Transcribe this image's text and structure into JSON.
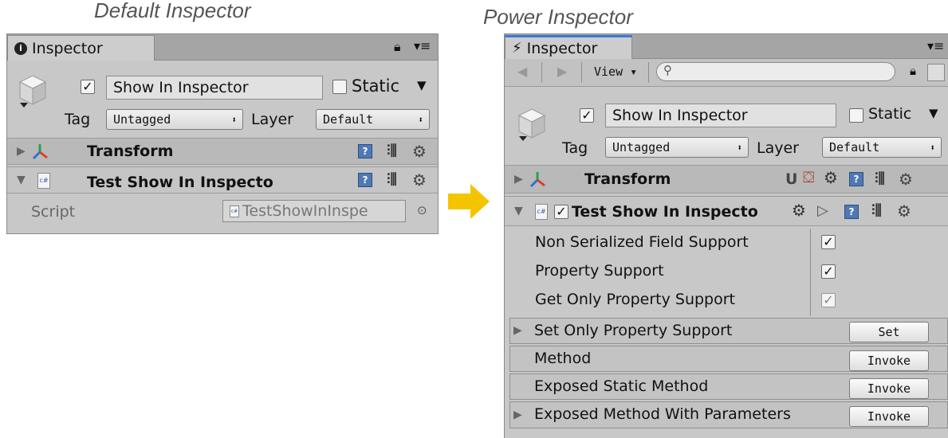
{
  "captions": {
    "left": "Default Inspector",
    "right": "Power Inspector"
  },
  "default_inspector": {
    "tab_title": "Inspector",
    "icons": [
      "info-icon",
      "lock-icon",
      "menu-icon",
      "cube-icon",
      "transform-axes-icon",
      "csharp-file-icon",
      "help-icon",
      "presets-icon",
      "gear-icon",
      "object-picker-icon"
    ],
    "gameobject": {
      "active": true,
      "name": "Show In Inspector",
      "static_label": "Static",
      "static_checked": false,
      "tag_label": "Tag",
      "tag_value": "Untagged",
      "layer_label": "Layer",
      "layer_value": "Default"
    },
    "components": [
      {
        "name": "Transform",
        "expanded": false
      },
      {
        "name": "Test Show In Inspecto",
        "expanded": true
      }
    ],
    "script_label": "Script",
    "script_value": "TestShowInInspe"
  },
  "power_inspector": {
    "tab_title": "Inspector",
    "view_label": "View",
    "search_placeholder": "",
    "icons": [
      "lightning-icon",
      "back-arrow-icon",
      "forward-arrow-icon",
      "search-icon",
      "lock-icon",
      "menu-icon",
      "cube-icon",
      "transform-axes-icon",
      "csharp-file-icon",
      "help-icon",
      "presets-icon",
      "gear-icon"
    ],
    "gameobject": {
      "active": true,
      "name": "Show In Inspector",
      "static_label": "Static",
      "static_checked": false,
      "tag_label": "Tag",
      "tag_value": "Untagged",
      "layer_label": "Layer",
      "layer_value": "Default"
    },
    "components": [
      {
        "name": "Transform",
        "expanded": false,
        "extra_icons": [
          "u-icon",
          "snap-cube-icon",
          "gear-arrow-icon"
        ]
      },
      {
        "name": "Test Show In Inspecto",
        "expanded": true,
        "enabled": true,
        "extra_icons": [
          "gear-arrow-icon",
          "play-icon"
        ]
      }
    ],
    "fields": [
      {
        "label": "Non Serialized Field Support",
        "checked": true,
        "disabled": false
      },
      {
        "label": "Property Support",
        "checked": true,
        "disabled": false
      },
      {
        "label": "Get Only Property Support",
        "checked": true,
        "disabled": true
      }
    ],
    "method_rows": [
      {
        "label": "Set Only Property Support",
        "button": "Set",
        "foldout": true
      },
      {
        "label": "Method",
        "button": "Invoke",
        "foldout": false
      },
      {
        "label": "Exposed Static Method",
        "button": "Invoke",
        "foldout": false
      },
      {
        "label": "Exposed Method With Parameters",
        "button": "Invoke",
        "foldout": true
      }
    ]
  },
  "colors": {
    "panel": "#c8c8c8",
    "header": "#b9b9b9",
    "arrow": "#f5c400"
  }
}
